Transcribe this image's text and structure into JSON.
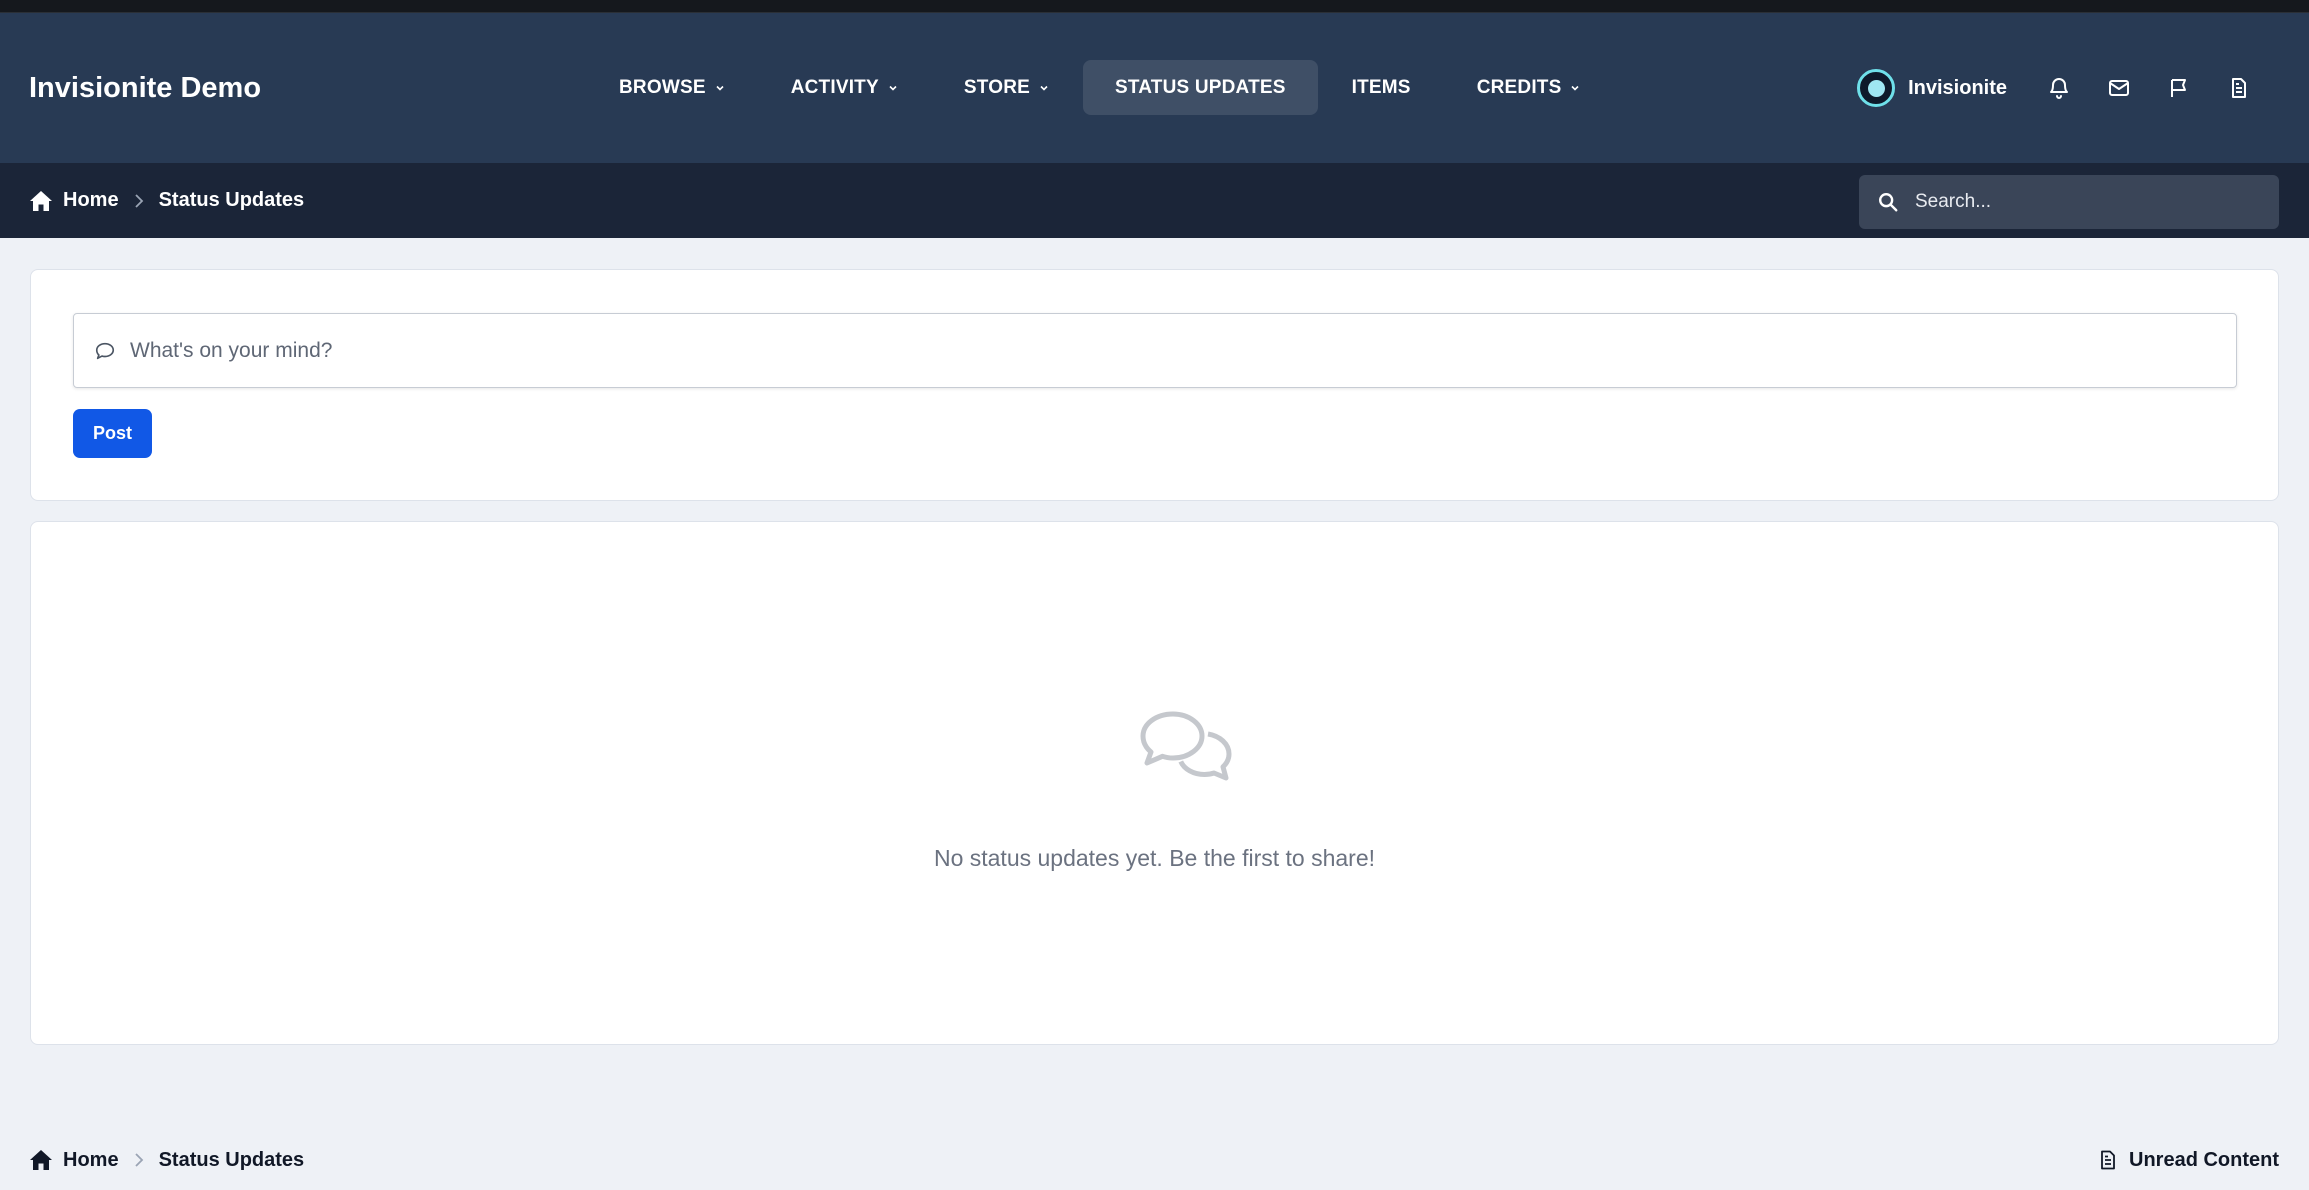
{
  "site": {
    "title": "Invisionite Demo"
  },
  "nav": {
    "items": [
      {
        "label": "BROWSE",
        "dropdown": true,
        "active": false
      },
      {
        "label": "ACTIVITY",
        "dropdown": true,
        "active": false
      },
      {
        "label": "STORE",
        "dropdown": true,
        "active": false
      },
      {
        "label": "STATUS UPDATES",
        "dropdown": false,
        "active": true
      },
      {
        "label": "ITEMS",
        "dropdown": false,
        "active": false
      },
      {
        "label": "CREDITS",
        "dropdown": true,
        "active": false
      }
    ]
  },
  "user": {
    "name": "Invisionite"
  },
  "header_icons": [
    "bell-icon",
    "envelope-icon",
    "flag-icon",
    "document-icon"
  ],
  "breadcrumb": {
    "home": "Home",
    "current": "Status Updates"
  },
  "search": {
    "placeholder": "Search..."
  },
  "compose": {
    "placeholder": "What's on your mind?",
    "post_label": "Post"
  },
  "feed": {
    "empty_message": "No status updates yet. Be the first to share!"
  },
  "footer": {
    "breadcrumb": {
      "home": "Home",
      "current": "Status Updates"
    },
    "unread_label": "Unread Content"
  },
  "colors": {
    "header_bg": "#283a54",
    "subbar_bg": "#1b2538",
    "active_nav_bg": "#3f4f66",
    "post_button": "#1158e6",
    "page_bg": "#eef1f6"
  }
}
